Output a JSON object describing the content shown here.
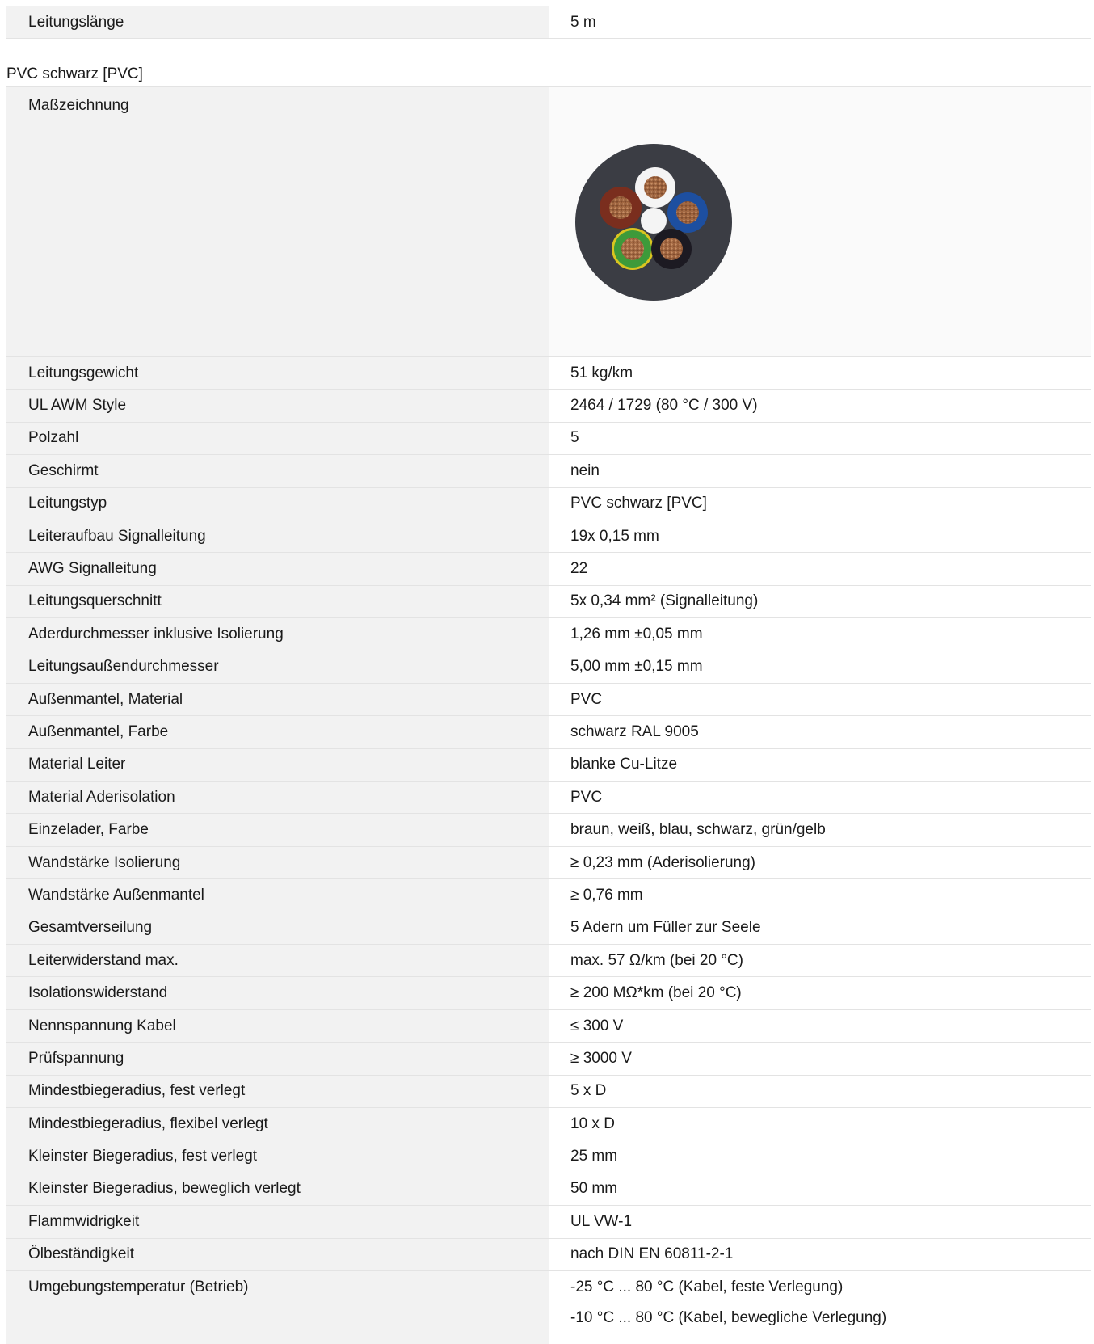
{
  "top_row": {
    "label": "Leitungslänge",
    "value": "5 m"
  },
  "section": {
    "title": "PVC schwarz [PVC]",
    "drawing_label": "Maßzeichnung",
    "drawing_icon": "cable-cross-section-icon"
  },
  "specs": [
    {
      "label": "Leitungsgewicht",
      "value": "51 kg/km"
    },
    {
      "label": "UL AWM Style",
      "value": "2464 / 1729 (80 °C / 300 V)"
    },
    {
      "label": "Polzahl",
      "value": "5"
    },
    {
      "label": "Geschirmt",
      "value": "nein"
    },
    {
      "label": "Leitungstyp",
      "value": "PVC schwarz [PVC]"
    },
    {
      "label": "Leiteraufbau Signalleitung",
      "value": "19x 0,15 mm"
    },
    {
      "label": "AWG Signalleitung",
      "value": "22"
    },
    {
      "label": "Leitungsquerschnitt",
      "value": "5x 0,34 mm² (Signalleitung)"
    },
    {
      "label": "Aderdurchmesser inklusive Isolierung",
      "value": "1,26 mm ±0,05 mm"
    },
    {
      "label": "Leitungsaußendurchmesser",
      "value": "5,00 mm ±0,15 mm"
    },
    {
      "label": "Außenmantel, Material",
      "value": "PVC"
    },
    {
      "label": "Außenmantel, Farbe",
      "value": "schwarz RAL 9005"
    },
    {
      "label": "Material Leiter",
      "value": "blanke Cu-Litze"
    },
    {
      "label": "Material Aderisolation",
      "value": "PVC"
    },
    {
      "label": "Einzelader, Farbe",
      "value": "braun, weiß, blau, schwarz, grün/gelb"
    },
    {
      "label": "Wandstärke Isolierung",
      "value": "≥ 0,23 mm (Aderisolierung)"
    },
    {
      "label": "Wandstärke Außenmantel",
      "value": "≥ 0,76 mm"
    },
    {
      "label": "Gesamtverseilung",
      "value": "5 Adern um Füller zur Seele"
    },
    {
      "label": "Leiterwiderstand max.",
      "value": "max. 57 Ω/km (bei 20 °C)"
    },
    {
      "label": "Isolationswiderstand",
      "value": "≥ 200 MΩ*km (bei 20 °C)"
    },
    {
      "label": "Nennspannung Kabel",
      "value": "≤ 300 V"
    },
    {
      "label": "Prüfspannung",
      "value": "≥ 3000 V"
    },
    {
      "label": "Mindestbiegeradius, fest verlegt",
      "value": "5 x D"
    },
    {
      "label": "Mindestbiegeradius, flexibel verlegt",
      "value": "10 x D"
    },
    {
      "label": "Kleinster Biegeradius, fest verlegt",
      "value": "25 mm"
    },
    {
      "label": "Kleinster Biegeradius, beweglich verlegt",
      "value": "50 mm"
    },
    {
      "label": "Flammwidrigkeit",
      "value": "UL VW-1"
    },
    {
      "label": "Ölbeständigkeit",
      "value": "nach DIN EN 60811-2-1"
    }
  ],
  "last_row": {
    "label": "Umgebungstemperatur (Betrieb)",
    "values": [
      "-25 °C ... 80 °C (Kabel, feste Verlegung)",
      "-10 °C ... 80 °C (Kabel, bewegliche Verlegung)"
    ]
  },
  "colors": {
    "jacket": "#3b3d44",
    "brown": "#7a2e1e",
    "white": "#f4f4f4",
    "blue": "#1d4fa0",
    "black": "#1c1a22",
    "green": "#3d9a3a",
    "yellow": "#d9c520",
    "copper": "#b87a4e"
  }
}
